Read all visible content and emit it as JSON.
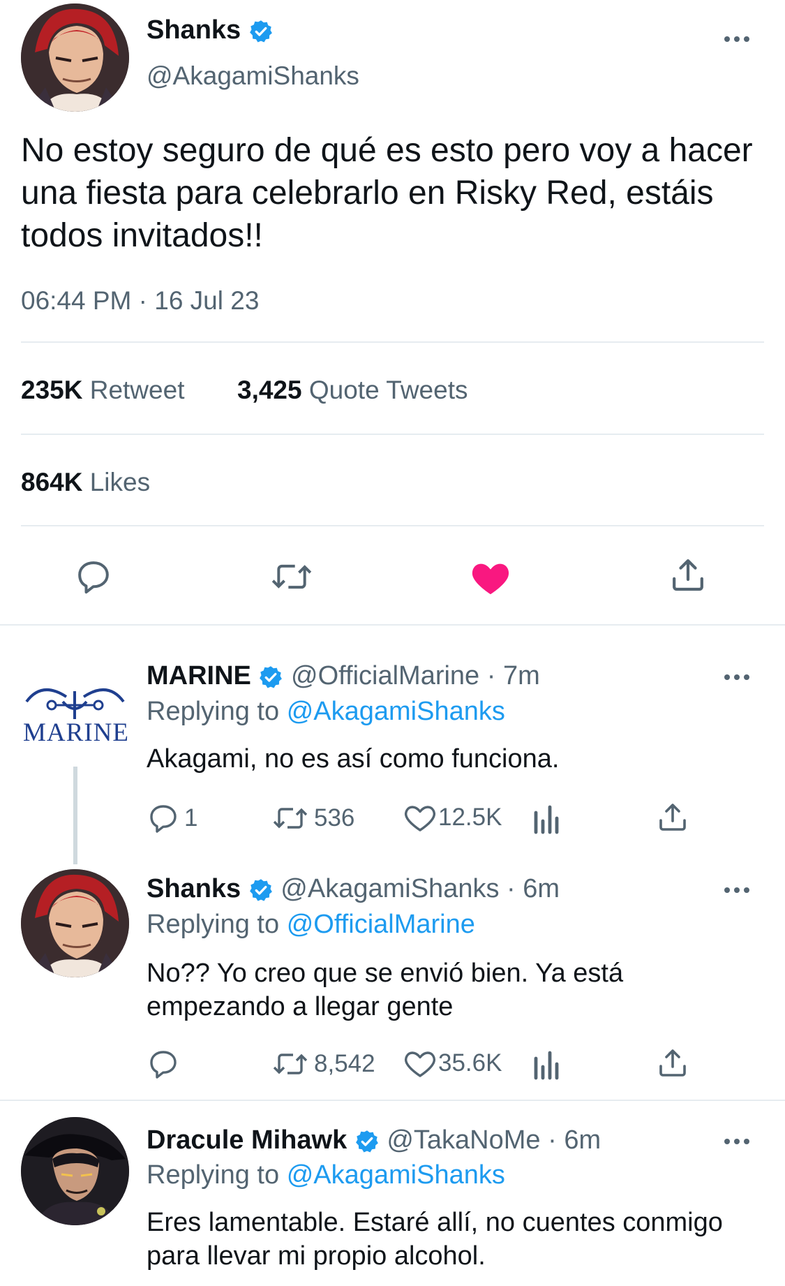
{
  "main_tweet": {
    "author_name": "Shanks",
    "author_handle": "@AkagamiShanks",
    "text": "No estoy seguro de qué es esto pero voy a hacer una fiesta para celebrarlo en Risky Red, estáis todos invitados!!",
    "timestamp": "06:44 PM · 16 Jul 23",
    "retweet_count": "235K",
    "retweet_label": "Retweet",
    "quote_count": "3,425",
    "quote_label": "Quote Tweets",
    "likes_count": "864K",
    "likes_label": "Likes",
    "actions": [
      "reply-icon",
      "retweet-icon",
      "heart-filled-icon",
      "share-icon"
    ],
    "liked_color": "#f91880"
  },
  "replies": [
    {
      "author_name": "MARINE",
      "author_handle": "@OfficialMarine · 7m",
      "replying_prefix": "Replying to",
      "replying_to": "@AkagamiShanks",
      "text": "Akagami, no es así como funciona.",
      "reply_count": "1",
      "retweet_count": "536",
      "like_count": "12.5K",
      "avatar_text": "MARINE"
    },
    {
      "author_name": "Shanks",
      "author_handle": "@AkagamiShanks · 6m",
      "replying_prefix": "Replying to",
      "replying_to": "@OfficialMarine",
      "text": "No?? Yo creo que se envió bien. Ya está empezando a llegar gente",
      "reply_count": "",
      "retweet_count": "8,542",
      "like_count": "35.6K"
    },
    {
      "author_name": "Dracule Mihawk",
      "author_handle": "@TakaNoMe · 6m",
      "replying_prefix": "Replying to",
      "replying_to": "@AkagamiShanks",
      "text": "Eres lamentable. Estaré allí, no cuentes conmigo para llevar mi propio alcohol."
    }
  ],
  "colors": {
    "accent": "#1d9bf0",
    "text": "#0f1419",
    "secondary": "#536471",
    "divider": "#e6ecf0",
    "marine_blue": "#1f3f8f"
  }
}
